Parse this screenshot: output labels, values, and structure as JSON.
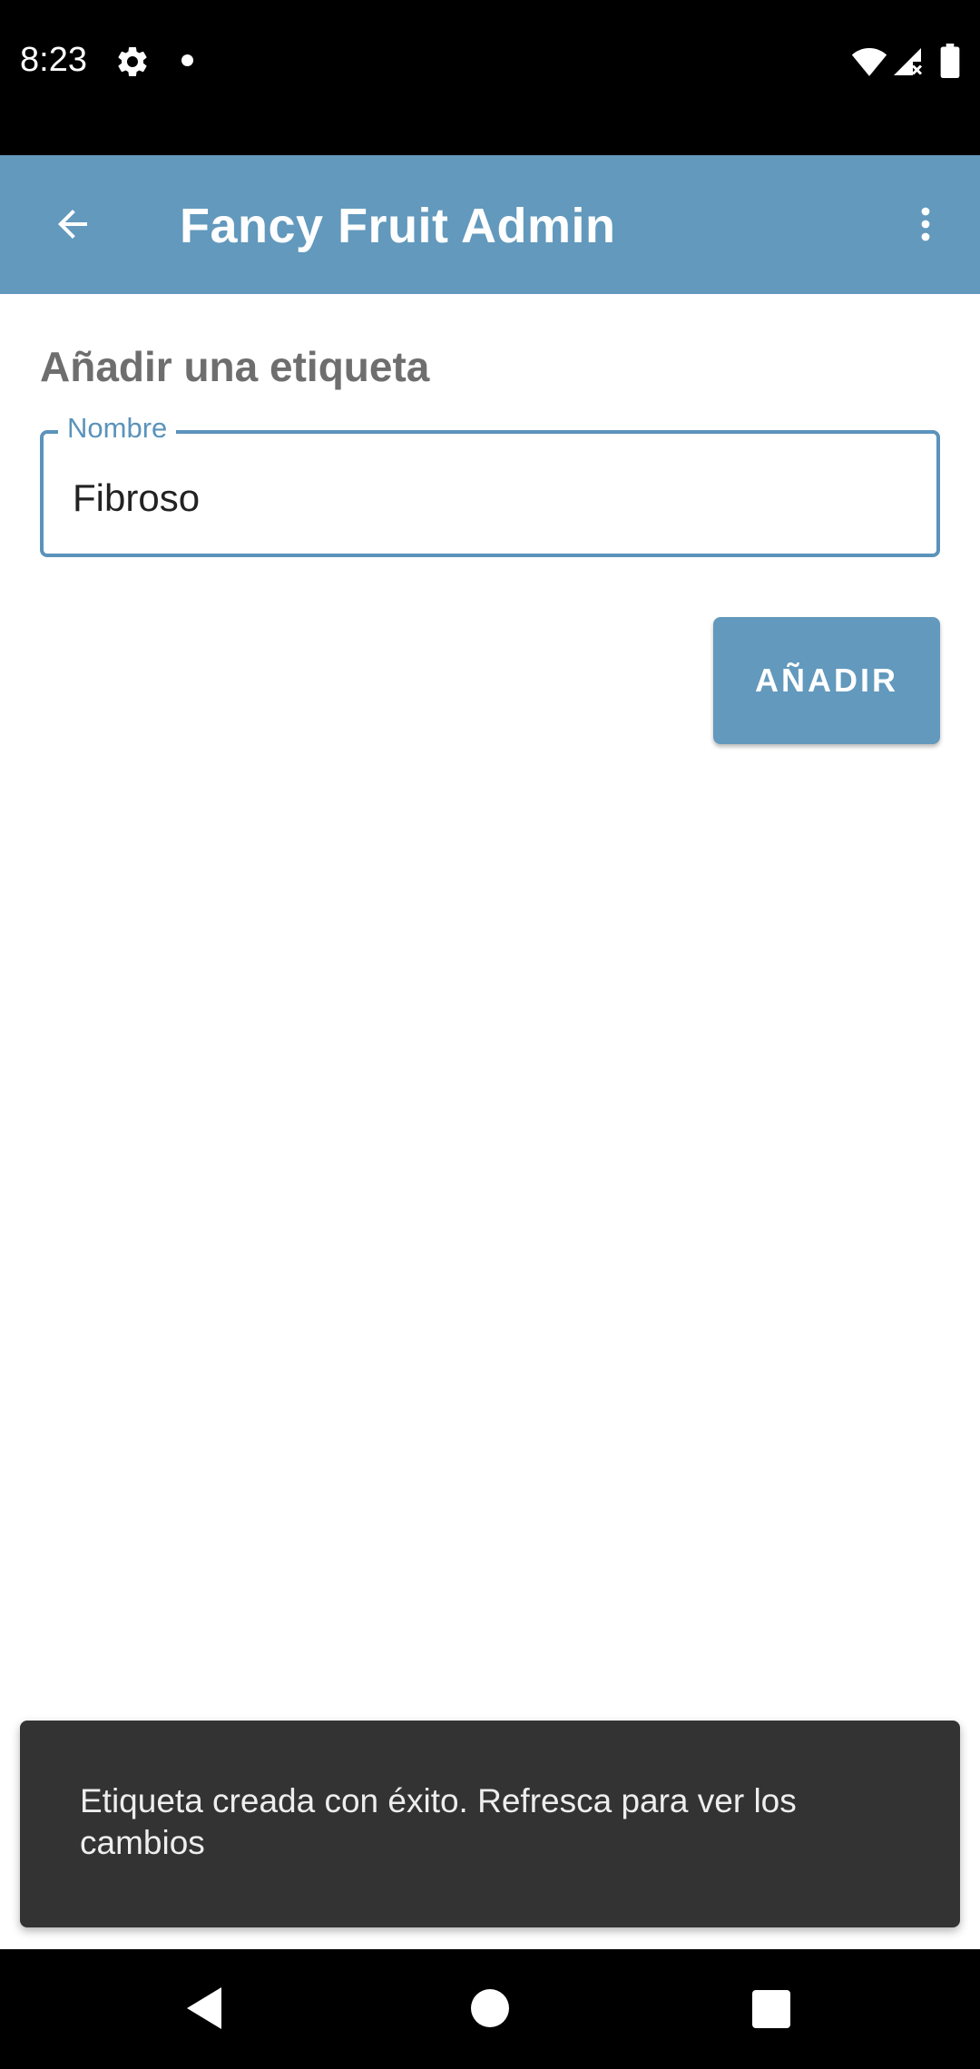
{
  "status_bar": {
    "time": "8:23",
    "icons": [
      "gear-icon",
      "notification-dot-icon",
      "wifi-icon",
      "signal-icon",
      "battery-icon"
    ]
  },
  "app_bar": {
    "title": "Fancy Fruit Admin",
    "back_icon": "arrow-back-icon",
    "menu_icon": "more-vert-icon",
    "color": "#6299bd"
  },
  "form": {
    "heading": "Añadir una etiqueta",
    "name_field": {
      "label": "Nombre",
      "value": "Fibroso"
    },
    "add_button_label": "AÑADIR"
  },
  "snackbar": {
    "message": "Etiqueta creada con éxito. Refresca para ver los cambios"
  },
  "nav_bar": {
    "icons": [
      "nav-back-icon",
      "nav-home-icon",
      "nav-recents-icon"
    ]
  }
}
